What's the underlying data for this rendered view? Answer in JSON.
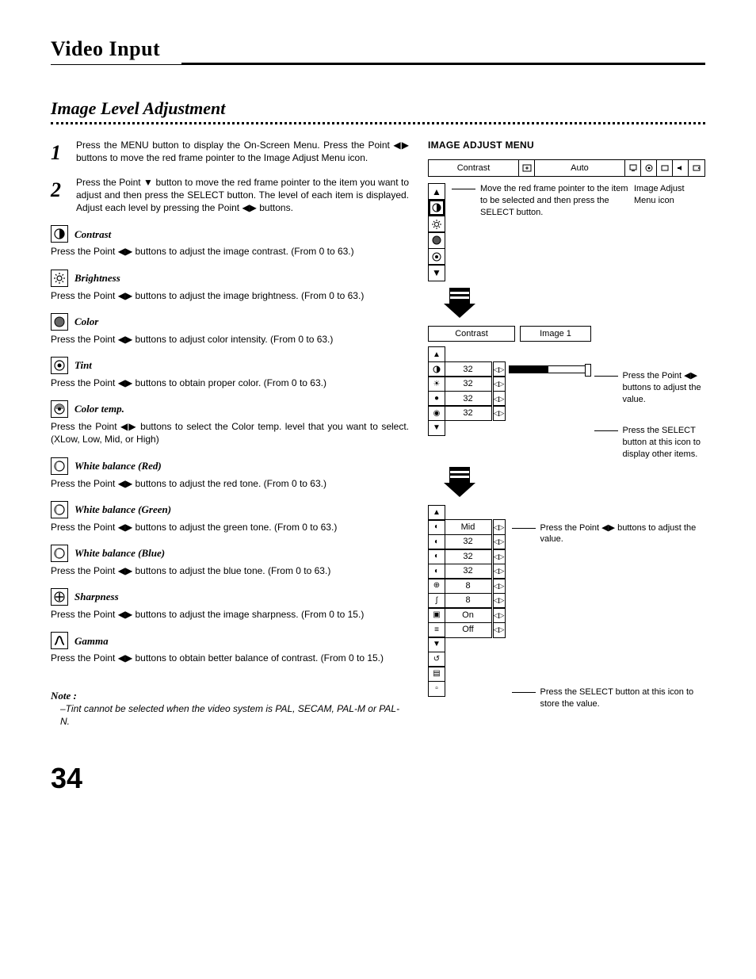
{
  "page_title": "Video Input",
  "section_title": "Image Level  Adjustment",
  "steps": [
    {
      "num": "1",
      "text": "Press the MENU button to display the On-Screen Menu.  Press the Point ◀▶ buttons to move the red frame pointer to the Image Adjust Menu icon."
    },
    {
      "num": "2",
      "text": "Press the Point ▼ button to move the red frame pointer to the item you want to adjust and then press the SELECT button.  The level of each item is displayed.  Adjust each level by pressing the Point ◀▶ buttons."
    }
  ],
  "items": [
    {
      "icon": "contrast-icon",
      "title": "Contrast",
      "desc": "Press the Point ◀▶ buttons to adjust the image contrast.  (From 0 to 63.)"
    },
    {
      "icon": "brightness-icon",
      "title": "Brightness",
      "desc": "Press the Point ◀▶ buttons to adjust the image brightness.  (From 0 to 63.)"
    },
    {
      "icon": "color-icon",
      "title": "Color",
      "desc": "Press the Point ◀▶ buttons to adjust color intensity.  (From 0 to 63.)"
    },
    {
      "icon": "tint-icon",
      "title": "Tint",
      "desc": "Press the Point ◀▶ buttons to obtain proper color.  (From 0 to 63.)"
    },
    {
      "icon": "colortemp-icon",
      "title": "Color temp.",
      "desc": "Press the Point ◀▶ buttons to select the Color temp. level that you want to select.  (XLow, Low, Mid, or High)"
    },
    {
      "icon": "wb-red-icon",
      "title": "White balance  (Red)",
      "desc": "Press the Point ◀▶ buttons to adjust the red tone.  (From 0 to 63.)"
    },
    {
      "icon": "wb-green-icon",
      "title": "White balance  (Green)",
      "desc": "Press the Point ◀▶ buttons to adjust the green tone.  (From 0 to 63.)"
    },
    {
      "icon": "wb-blue-icon",
      "title": "White balance  (Blue)",
      "desc": "Press the Point ◀▶ buttons to adjust the blue tone.  (From 0 to 63.)"
    },
    {
      "icon": "sharpness-icon",
      "title": "Sharpness",
      "desc": "Press the Point ◀▶ buttons to adjust the image sharpness.  (From 0 to  15.)"
    },
    {
      "icon": "gamma-icon",
      "title": "Gamma",
      "desc": "Press the Point ◀▶ buttons to obtain better balance of contrast.  (From 0 to 15.)"
    }
  ],
  "note_label": "Note :",
  "note_text": "–Tint cannot be selected when the video system is PAL, SECAM, PAL-M or PAL-N.",
  "page_number": "34",
  "right": {
    "menu_title": "IMAGE ADJUST MENU",
    "menubar_label": "Contrast",
    "menubar_mode": "Auto",
    "annot_pointer": "Move the red frame pointer to the item to be selected and then press the SELECT button.",
    "annot_icon": "Image Adjust Menu icon",
    "panel2_label": "Contrast",
    "panel2_mode": "Image 1",
    "vals1": [
      "32",
      "32",
      "32",
      "32"
    ],
    "annot_adjust": "Press the Point ◀▶ buttons to adjust the value.",
    "annot_other": "Press the SELECT button at this icon to display other items.",
    "vals2": [
      "Mid",
      "32",
      "32",
      "32",
      "8",
      "8",
      "On",
      "Off"
    ],
    "annot_adjust2": "Press the Point ◀▶ buttons to adjust the value.",
    "annot_store": "Press the SELECT button at this icon to store the value."
  }
}
